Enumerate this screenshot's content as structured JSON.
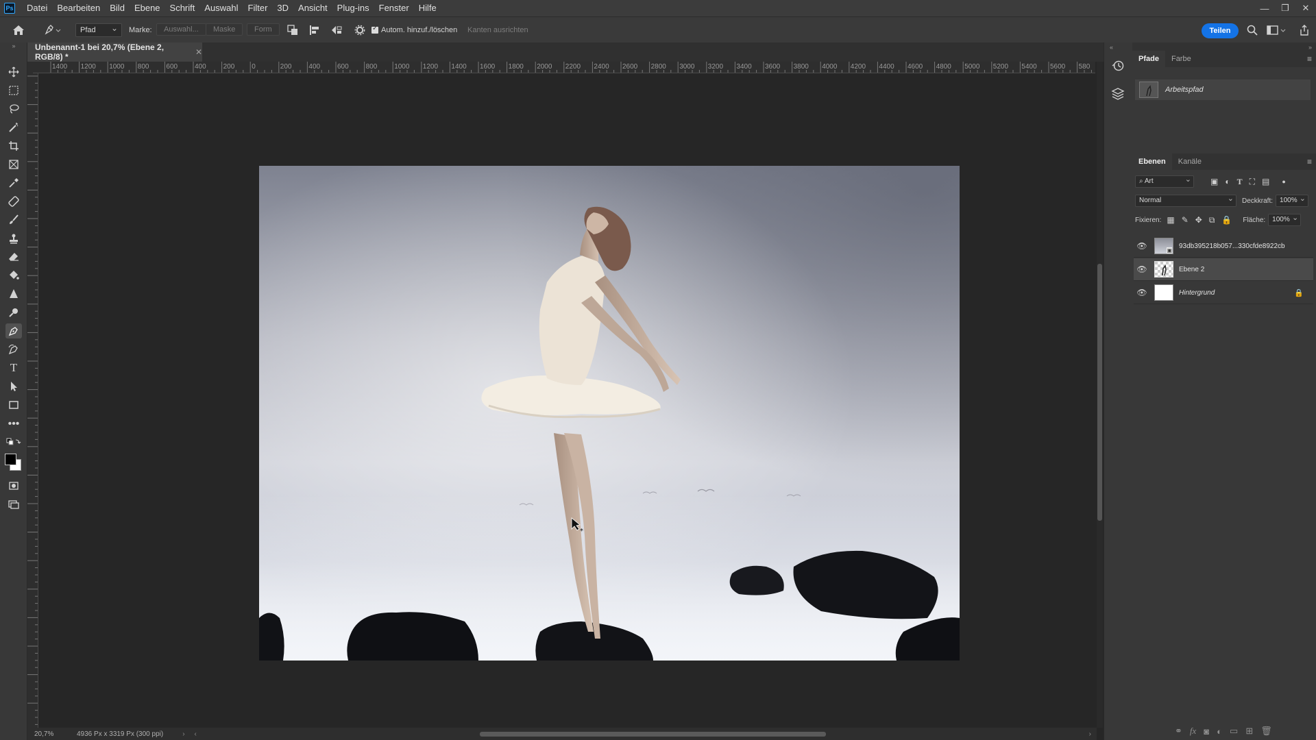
{
  "app": {
    "logo": "Ps",
    "menu": [
      "Datei",
      "Bearbeiten",
      "Bild",
      "Ebene",
      "Schrift",
      "Auswahl",
      "Filter",
      "3D",
      "Ansicht",
      "Plug-ins",
      "Fenster",
      "Hilfe"
    ],
    "window_controls": [
      "—",
      "❐",
      "✕"
    ]
  },
  "options_bar": {
    "tool_mode": "Pfad",
    "marke_label": "Marke:",
    "auswahl_btn": "Auswahl...",
    "maske_btn": "Maske",
    "form_btn": "Form",
    "auto_add_delete_label": "Autom. hinzuf./löschen",
    "auto_add_delete_checked": true,
    "align_edges_label": "Kanten ausrichten",
    "share_label": "Teilen"
  },
  "document": {
    "tab_title": "Unbenannt-1 bei 20,7% (Ebene 2, RGB/8) *",
    "zoom": "20,7%",
    "size_info": "4936 Px x 3319 Px (300 ppi)"
  },
  "ruler": {
    "h_labels": [
      "1400",
      "1200",
      "1000",
      "800",
      "600",
      "400",
      "200",
      "0",
      "200",
      "400",
      "600",
      "800",
      "1000",
      "1200",
      "1400",
      "1600",
      "1800",
      "2000",
      "2200",
      "2400",
      "2600",
      "2800",
      "3000",
      "3200",
      "3400",
      "3600",
      "3800",
      "4000",
      "4200",
      "4400",
      "4600",
      "4800",
      "5000",
      "5200",
      "5400",
      "5600",
      "580"
    ]
  },
  "paths_panel": {
    "tabs": [
      "Pfade",
      "Farbe"
    ],
    "active_tab": "Pfade",
    "paths": [
      {
        "name": "Arbeitspfad"
      }
    ]
  },
  "layers_panel": {
    "tabs": [
      "Ebenen",
      "Kanäle"
    ],
    "active_tab": "Ebenen",
    "filter_kind": "Art",
    "blend_mode": "Normal",
    "opacity_label": "Deckkraft:",
    "opacity": "100%",
    "lock_label": "Fixieren:",
    "fill_label": "Fläche:",
    "fill": "100%",
    "layers": [
      {
        "name": "93db395218b057...330cfde8922cb",
        "visible": true,
        "selected": false,
        "locked": false,
        "italic": false
      },
      {
        "name": "Ebene 2",
        "visible": true,
        "selected": true,
        "locked": false,
        "italic": false
      },
      {
        "name": "Hintergrund",
        "visible": true,
        "selected": false,
        "locked": true,
        "italic": true
      }
    ]
  },
  "colors": {
    "accent": "#1473e6",
    "foreground": "#000000",
    "background": "#ffffff"
  }
}
